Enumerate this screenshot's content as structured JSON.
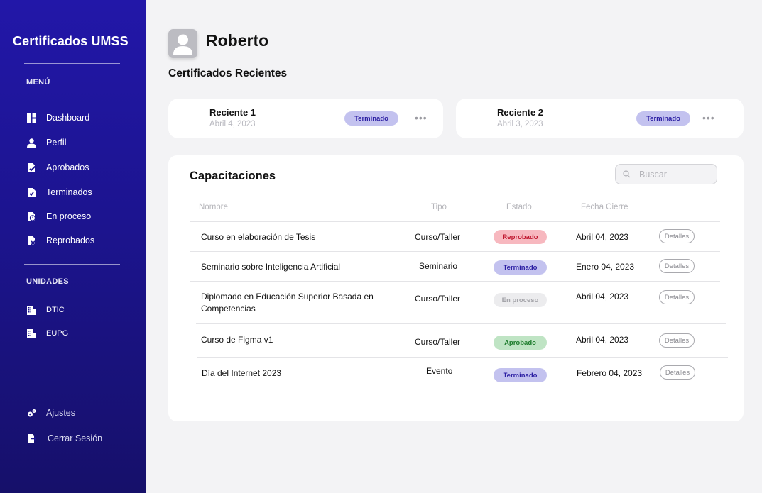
{
  "sidebar": {
    "brand": "Certificados UMSS",
    "menu_title": "MENÚ",
    "menu": [
      {
        "label": "Dashboard",
        "icon": "dashboard-icon"
      },
      {
        "label": "Perfil",
        "icon": "user-icon"
      },
      {
        "label": "Aprobados",
        "icon": "approved-doc-icon"
      },
      {
        "label": "Terminados",
        "icon": "finished-doc-icon"
      },
      {
        "label": "En proceso",
        "icon": "in-progress-doc-icon"
      },
      {
        "label": "Reprobados",
        "icon": "failed-doc-icon"
      }
    ],
    "units_title": "UNIDADES",
    "units": [
      {
        "label": "DTIC",
        "icon": "building-icon"
      },
      {
        "label": "EUPG",
        "icon": "building-icon"
      }
    ],
    "bottom": [
      {
        "label": "Ajustes",
        "icon": "settings-icon"
      },
      {
        "label": "Cerrar Sesión",
        "icon": "logout-icon"
      }
    ]
  },
  "header": {
    "username": "Roberto",
    "recent_title": "Certificados Recientes"
  },
  "recent": [
    {
      "name": "Reciente 1",
      "date": "Abril 4, 2023",
      "status": "Terminado"
    },
    {
      "name": "Reciente 2",
      "date": "Abril 3, 2023",
      "status": "Terminado"
    }
  ],
  "table": {
    "title": "Capacitaciones",
    "search_placeholder": "Buscar",
    "headers": {
      "name": "Nombre",
      "type": "Tipo",
      "status": "Estado",
      "date": "Fecha Cierre"
    },
    "details_label": "Detalles",
    "rows": [
      {
        "name": "Curso en elaboración de Tesis",
        "type": "Curso/Taller",
        "status": "Reprobado",
        "date": "Abril 04, 2023"
      },
      {
        "name": "Seminario sobre Inteligencia Artificial",
        "type": "Seminario",
        "status": "Terminado",
        "date": "Enero 04, 2023"
      },
      {
        "name": "Diplomado en Educación Superior Basada en Competencias",
        "type": "Curso/Taller",
        "status": "En proceso",
        "date": "Abril 04, 2023"
      },
      {
        "name": "Curso de Figma v1",
        "type": "Curso/Taller",
        "status": "Aprobado",
        "date": "Abril 04, 2023"
      },
      {
        "name": "Día del Internet 2023",
        "type": "Evento",
        "status": "Terminado",
        "date": "Febrero 04, 2023"
      }
    ]
  },
  "colors": {
    "sidebar_top": "#2217a8",
    "sidebar_bottom": "#16106a",
    "terminado": "#c3c2ef",
    "reprobado": "#f7b8bf",
    "en_proceso": "#ececee",
    "aprobado": "#bfe4c4"
  }
}
